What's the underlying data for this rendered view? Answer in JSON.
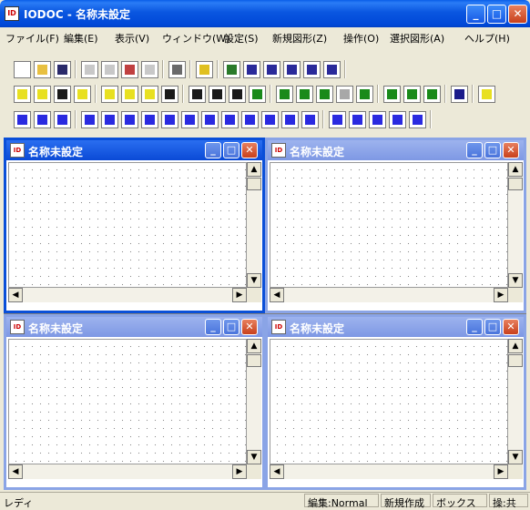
{
  "window": {
    "title": "IODOC - 名称未設定",
    "app_icon_text": "ID",
    "accent": "#0a4fd8"
  },
  "menus": [
    "ファイル(F)",
    "編集(E)",
    "表示(V)",
    "ウィンドウ(W)",
    "設定(S)",
    "新規図形(Z)",
    "操作(O)",
    "選択図形(A)",
    "ヘルプ(H)"
  ],
  "toolbars": {
    "row1": [
      "new-icon",
      "open-icon",
      "save-icon",
      "cut-icon",
      "copy-icon",
      "spell-icon",
      "paste-icon",
      "page-icon",
      "help-icon",
      "image-icon",
      "text-icon",
      "zoom-icon",
      "frame-icon",
      "table-icon",
      "window-icon"
    ],
    "row2": [
      "grid-icon",
      "number-icon",
      "hatch-icon",
      "grid-yellow-icon",
      "zoom-in-icon",
      "rect-icon",
      "zoom-out-icon",
      "copy-shape-icon",
      "square-icon",
      "square2-icon",
      "square3-icon",
      "chart-icon",
      "arrow-icon",
      "move-icon",
      "group-icon",
      "tile-icon",
      "intersect-icon",
      "cross-icon",
      "split-icon",
      "merge-icon",
      "select-icon",
      "connect-icon"
    ],
    "row3": [
      "text-a-icon",
      "text-ab-icon",
      "text-az-icon",
      "hline-icon",
      "vline-icon",
      "diagonal-icon",
      "square-shape-icon",
      "round-rect-icon",
      "diamond-icon",
      "ellipse-icon",
      "hex-icon",
      "cylinder-icon",
      "list-icon",
      "tree-icon",
      "bars-icon",
      "parallelogram-icon",
      "curve-icon",
      "circle-icon",
      "cog-icon",
      "star-icon"
    ]
  },
  "children": [
    {
      "title": "名称未設定",
      "active": true
    },
    {
      "title": "名称未設定",
      "active": false
    },
    {
      "title": "名称未設定",
      "active": false
    },
    {
      "title": "名称未設定",
      "active": false
    }
  ],
  "status": {
    "ready": "レディ",
    "mode": "編集:Normal",
    "new_shape": "新規作成",
    "shape_kind": "ボックス",
    "operation": "操:共"
  }
}
